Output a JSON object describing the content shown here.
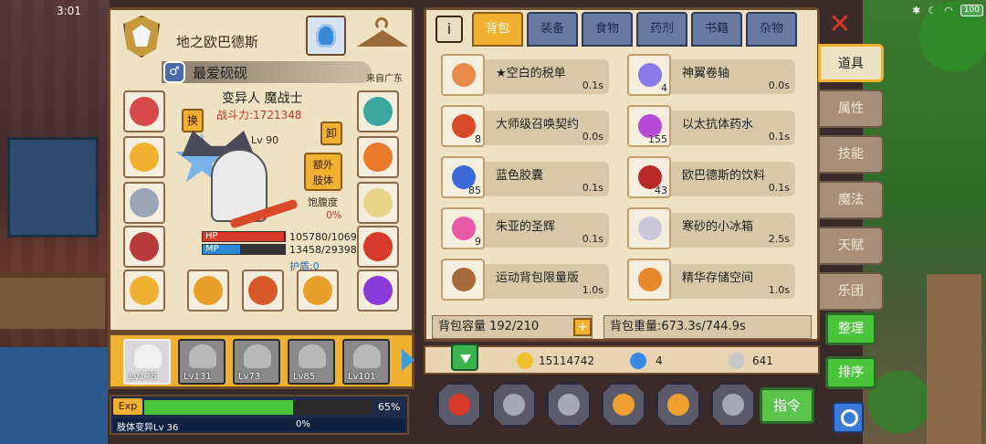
{
  "status_bar": {
    "time": "3:01",
    "battery": "100"
  },
  "character": {
    "guild_name": "地之欧巴德斯",
    "title": "最爱砚砚",
    "gender_symbol": "♂",
    "origin": "来自广东",
    "class_name": "变异人 魔战士",
    "power_label": "战斗力:1721348",
    "level": "Lv 90",
    "swap_label": "换",
    "unequip_label": "卸",
    "extra_body_label": "额外\n肢体",
    "hunger_label": "饱腹度",
    "hunger_value": "0%",
    "hp_label": "HP",
    "hp_value": "105780/1069",
    "hp_fraction": 0.99,
    "mp_label": "MP",
    "mp_value": "13458/29398",
    "mp_fraction": 0.46,
    "shield": "护盾:0"
  },
  "equipment_slots": [
    {
      "name": "headgear",
      "color": "#d84a4a"
    },
    {
      "name": "amulet",
      "color": "#f0b030"
    },
    {
      "name": "armor",
      "color": "#9aa6b8"
    },
    {
      "name": "gauntlet",
      "color": "#b83a3a"
    },
    {
      "name": "ring",
      "color": "#f0b030"
    },
    {
      "name": "crystal",
      "color": "#3aa8a0"
    },
    {
      "name": "pumpkin",
      "color": "#e87a2a"
    },
    {
      "name": "mirror",
      "color": "#e8d488"
    },
    {
      "name": "boots",
      "color": "#d83a2a"
    },
    {
      "name": "orb",
      "color": "#8a3ad8"
    },
    {
      "name": "staff",
      "color": "#e8a02a"
    },
    {
      "name": "spear",
      "color": "#d85a2a"
    },
    {
      "name": "bow",
      "color": "#e8a02a"
    }
  ],
  "party": [
    {
      "level": "Lv178",
      "active": true
    },
    {
      "level": "Lv131",
      "active": false
    },
    {
      "level": "Lv73",
      "active": false
    },
    {
      "level": "Lv85",
      "active": false
    },
    {
      "level": "Lv101",
      "active": false
    }
  ],
  "exp": {
    "label": "Exp",
    "fraction": 0.65,
    "percent": "65%",
    "sub_label": "肢体变异Lv 36",
    "sub_percent": "0%"
  },
  "inventory": {
    "info_icon": "i",
    "tabs": [
      "背包",
      "装备",
      "食物",
      "药剂",
      "书籍",
      "杂物"
    ],
    "items": [
      {
        "name": "★空白的税单",
        "weight": "0.1s",
        "count": "",
        "color": "#e88a4a"
      },
      {
        "name": "神翼卷轴",
        "weight": "0.0s",
        "count": "4",
        "color": "#8a7ae8"
      },
      {
        "name": "大师级召唤契约",
        "weight": "0.0s",
        "count": "8",
        "color": "#d84a2a"
      },
      {
        "name": "以太抗体药水",
        "weight": "0.1s",
        "count": "155",
        "color": "#b84ad8"
      },
      {
        "name": "蓝色胶囊",
        "weight": "0.1s",
        "count": "85",
        "color": "#3a6ad8"
      },
      {
        "name": "欧巴德斯的饮料",
        "weight": "0.1s",
        "count": "43",
        "color": "#b82a2a"
      },
      {
        "name": "朱亚的圣辉",
        "weight": "0.1s",
        "count": "9",
        "color": "#e85aa8"
      },
      {
        "name": "寒砂的小冰箱",
        "weight": "2.5s",
        "count": "",
        "color": "#c8c8d8"
      },
      {
        "name": "运动背包限量版",
        "weight": "1.0s",
        "count": "",
        "color": "#a86a3a"
      },
      {
        "name": "精华存储空间",
        "weight": "1.0s",
        "count": "",
        "color": "#e8882a"
      }
    ],
    "capacity": "背包容量 192/210",
    "capacity_plus": "+",
    "weight": "背包重量:673.3s/744.9s"
  },
  "currency": [
    {
      "name": "gold",
      "value": "15114742",
      "color": "#f0c030"
    },
    {
      "name": "diamond",
      "value": "4",
      "color": "#3a8ae8"
    },
    {
      "name": "silver",
      "value": "641",
      "color": "#c8c8c8"
    }
  ],
  "actions": {
    "buttons": [
      {
        "name": "rank",
        "color": "#d83a2a"
      },
      {
        "name": "book",
        "color": "#a8a8b8"
      },
      {
        "name": "magnify",
        "color": "#a8a8b8"
      },
      {
        "name": "forge",
        "color": "#f0a030"
      },
      {
        "name": "skill",
        "color": "#f0a030"
      },
      {
        "name": "cycle",
        "color": "#a8a8b8"
      }
    ],
    "command_label": "指令"
  },
  "side_tabs": [
    "道具",
    "属性",
    "技能",
    "魔法",
    "天赋",
    "乐团"
  ],
  "side_buttons": {
    "organize": "整理",
    "sort": "排序"
  },
  "close_symbol": "✕"
}
